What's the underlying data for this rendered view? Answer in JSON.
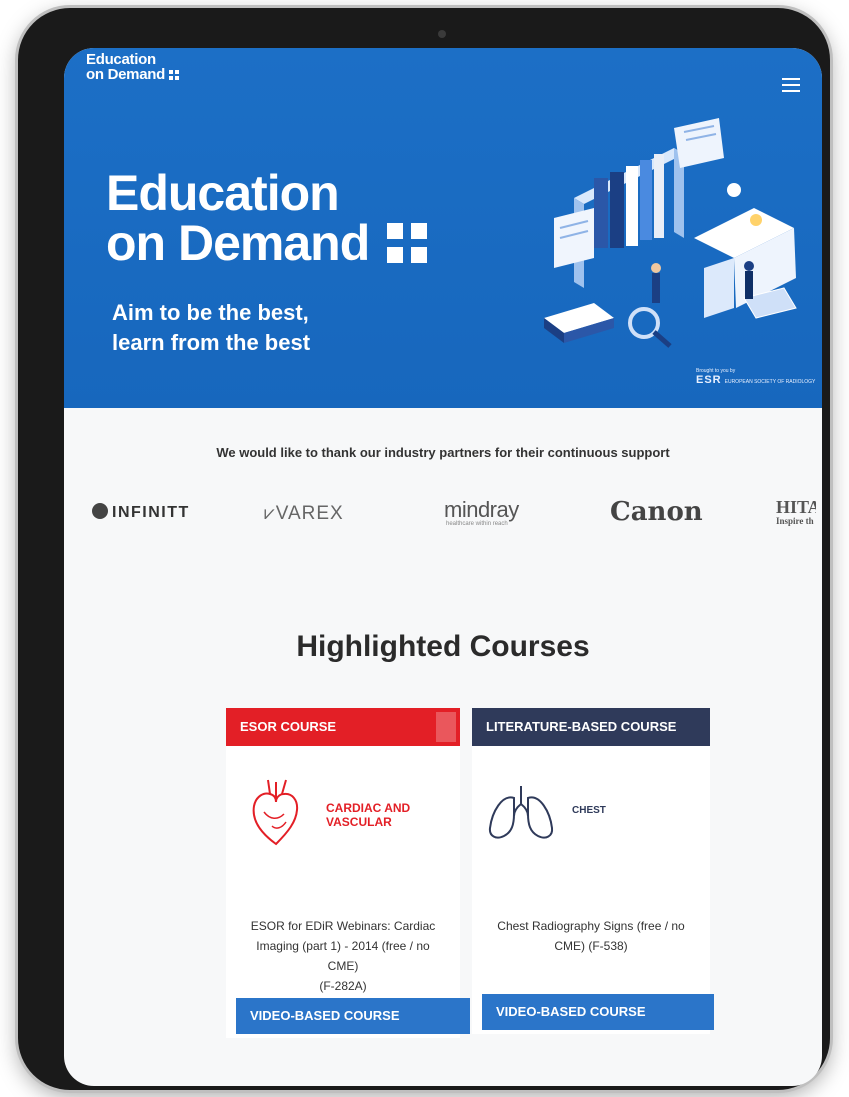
{
  "site": {
    "logo_line1": "Education",
    "logo_line2": "on Demand",
    "menu_icon": "hamburger-menu-icon"
  },
  "hero": {
    "title_line1": "Education",
    "title_line2": "on Demand",
    "tagline_line1": "Aim to be the best,",
    "tagline_line2": "learn from the best",
    "brought_by": "Brought to you by",
    "brought_org": "ESR",
    "brought_org_full": "EUROPEAN SOCIETY OF RADIOLOGY",
    "background_color": "#1c6fc6"
  },
  "partners": {
    "intro": "We would like to thank our industry partners for their continuous support",
    "logos": [
      {
        "name": "INFINITT"
      },
      {
        "name": "VAREX"
      },
      {
        "name": "mindray",
        "sub": "healthcare within reach"
      },
      {
        "name": "Canon"
      },
      {
        "name": "HITA",
        "sub": "Inspire th"
      }
    ]
  },
  "courses": {
    "section_title": "Highlighted Courses",
    "items": [
      {
        "badge": "ESOR COURSE",
        "badge_color": "#e31f26",
        "topic_line1": "CARDIAC AND",
        "topic_line2": "VASCULAR",
        "icon": "heart-icon",
        "desc_line1": "ESOR for EDiR Webinars: Cardiac",
        "desc_line2": "Imaging (part 1) - 2014 (free / no CME)",
        "desc_line3": "(F-282A)",
        "type_button": "VIDEO-BASED COURSE"
      },
      {
        "badge": "LITERATURE-BASED COURSE",
        "badge_color": "#2f3a5a",
        "topic_line1": "CHEST",
        "icon": "lungs-icon",
        "desc_line1": "Chest Radiography Signs (free / no",
        "desc_line2": "CME) (F-538)",
        "type_button": "VIDEO-BASED COURSE"
      }
    ]
  },
  "colors": {
    "accent_blue": "#2b75c9",
    "esor_red": "#e31f26",
    "literature_navy": "#2f3a5a"
  }
}
